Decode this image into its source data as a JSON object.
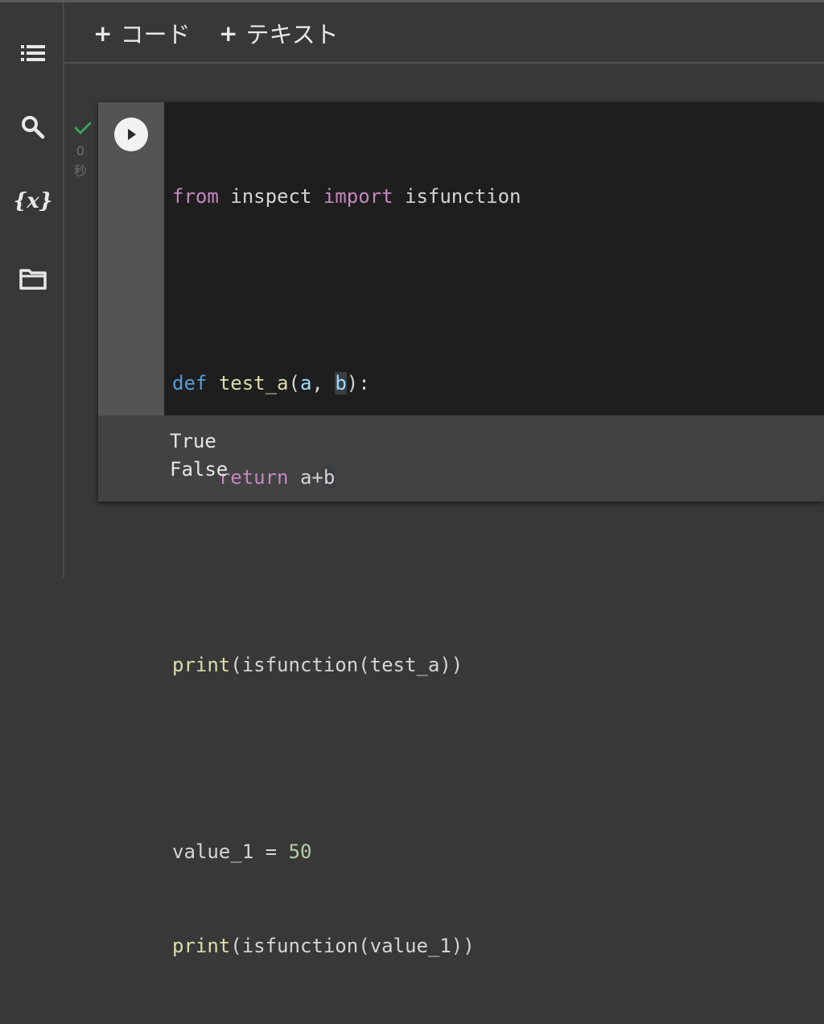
{
  "toolbar": {
    "add_code_plus": "+",
    "add_code_label": "コード",
    "add_text_plus": "+",
    "add_text_label": "テキスト"
  },
  "sidebar": {
    "items": [
      {
        "icon": "table-of-contents-icon"
      },
      {
        "icon": "search-icon"
      },
      {
        "icon": "variables-icon",
        "glyph": "{x}"
      },
      {
        "icon": "folder-icon"
      }
    ]
  },
  "cell": {
    "status": "0\n秒",
    "status_seconds": "0",
    "status_unit": "秒",
    "code_lines": [
      "from inspect import isfunction",
      "",
      "def test_a(a, b):",
      "    return a+b",
      "",
      "print(isfunction(test_a))",
      "",
      "value_1 = 50",
      "print(isfunction(value_1))"
    ],
    "output_lines": [
      "True",
      "False"
    ]
  },
  "colors": {
    "background": "#383838",
    "editor": "#1e1e1e",
    "gutter": "#545454",
    "keyword": "#c586c0",
    "def_keyword": "#569cd6",
    "function": "#dcdcaa",
    "parameter": "#9cdcfe",
    "number": "#b5cea8",
    "success": "#34a853"
  }
}
